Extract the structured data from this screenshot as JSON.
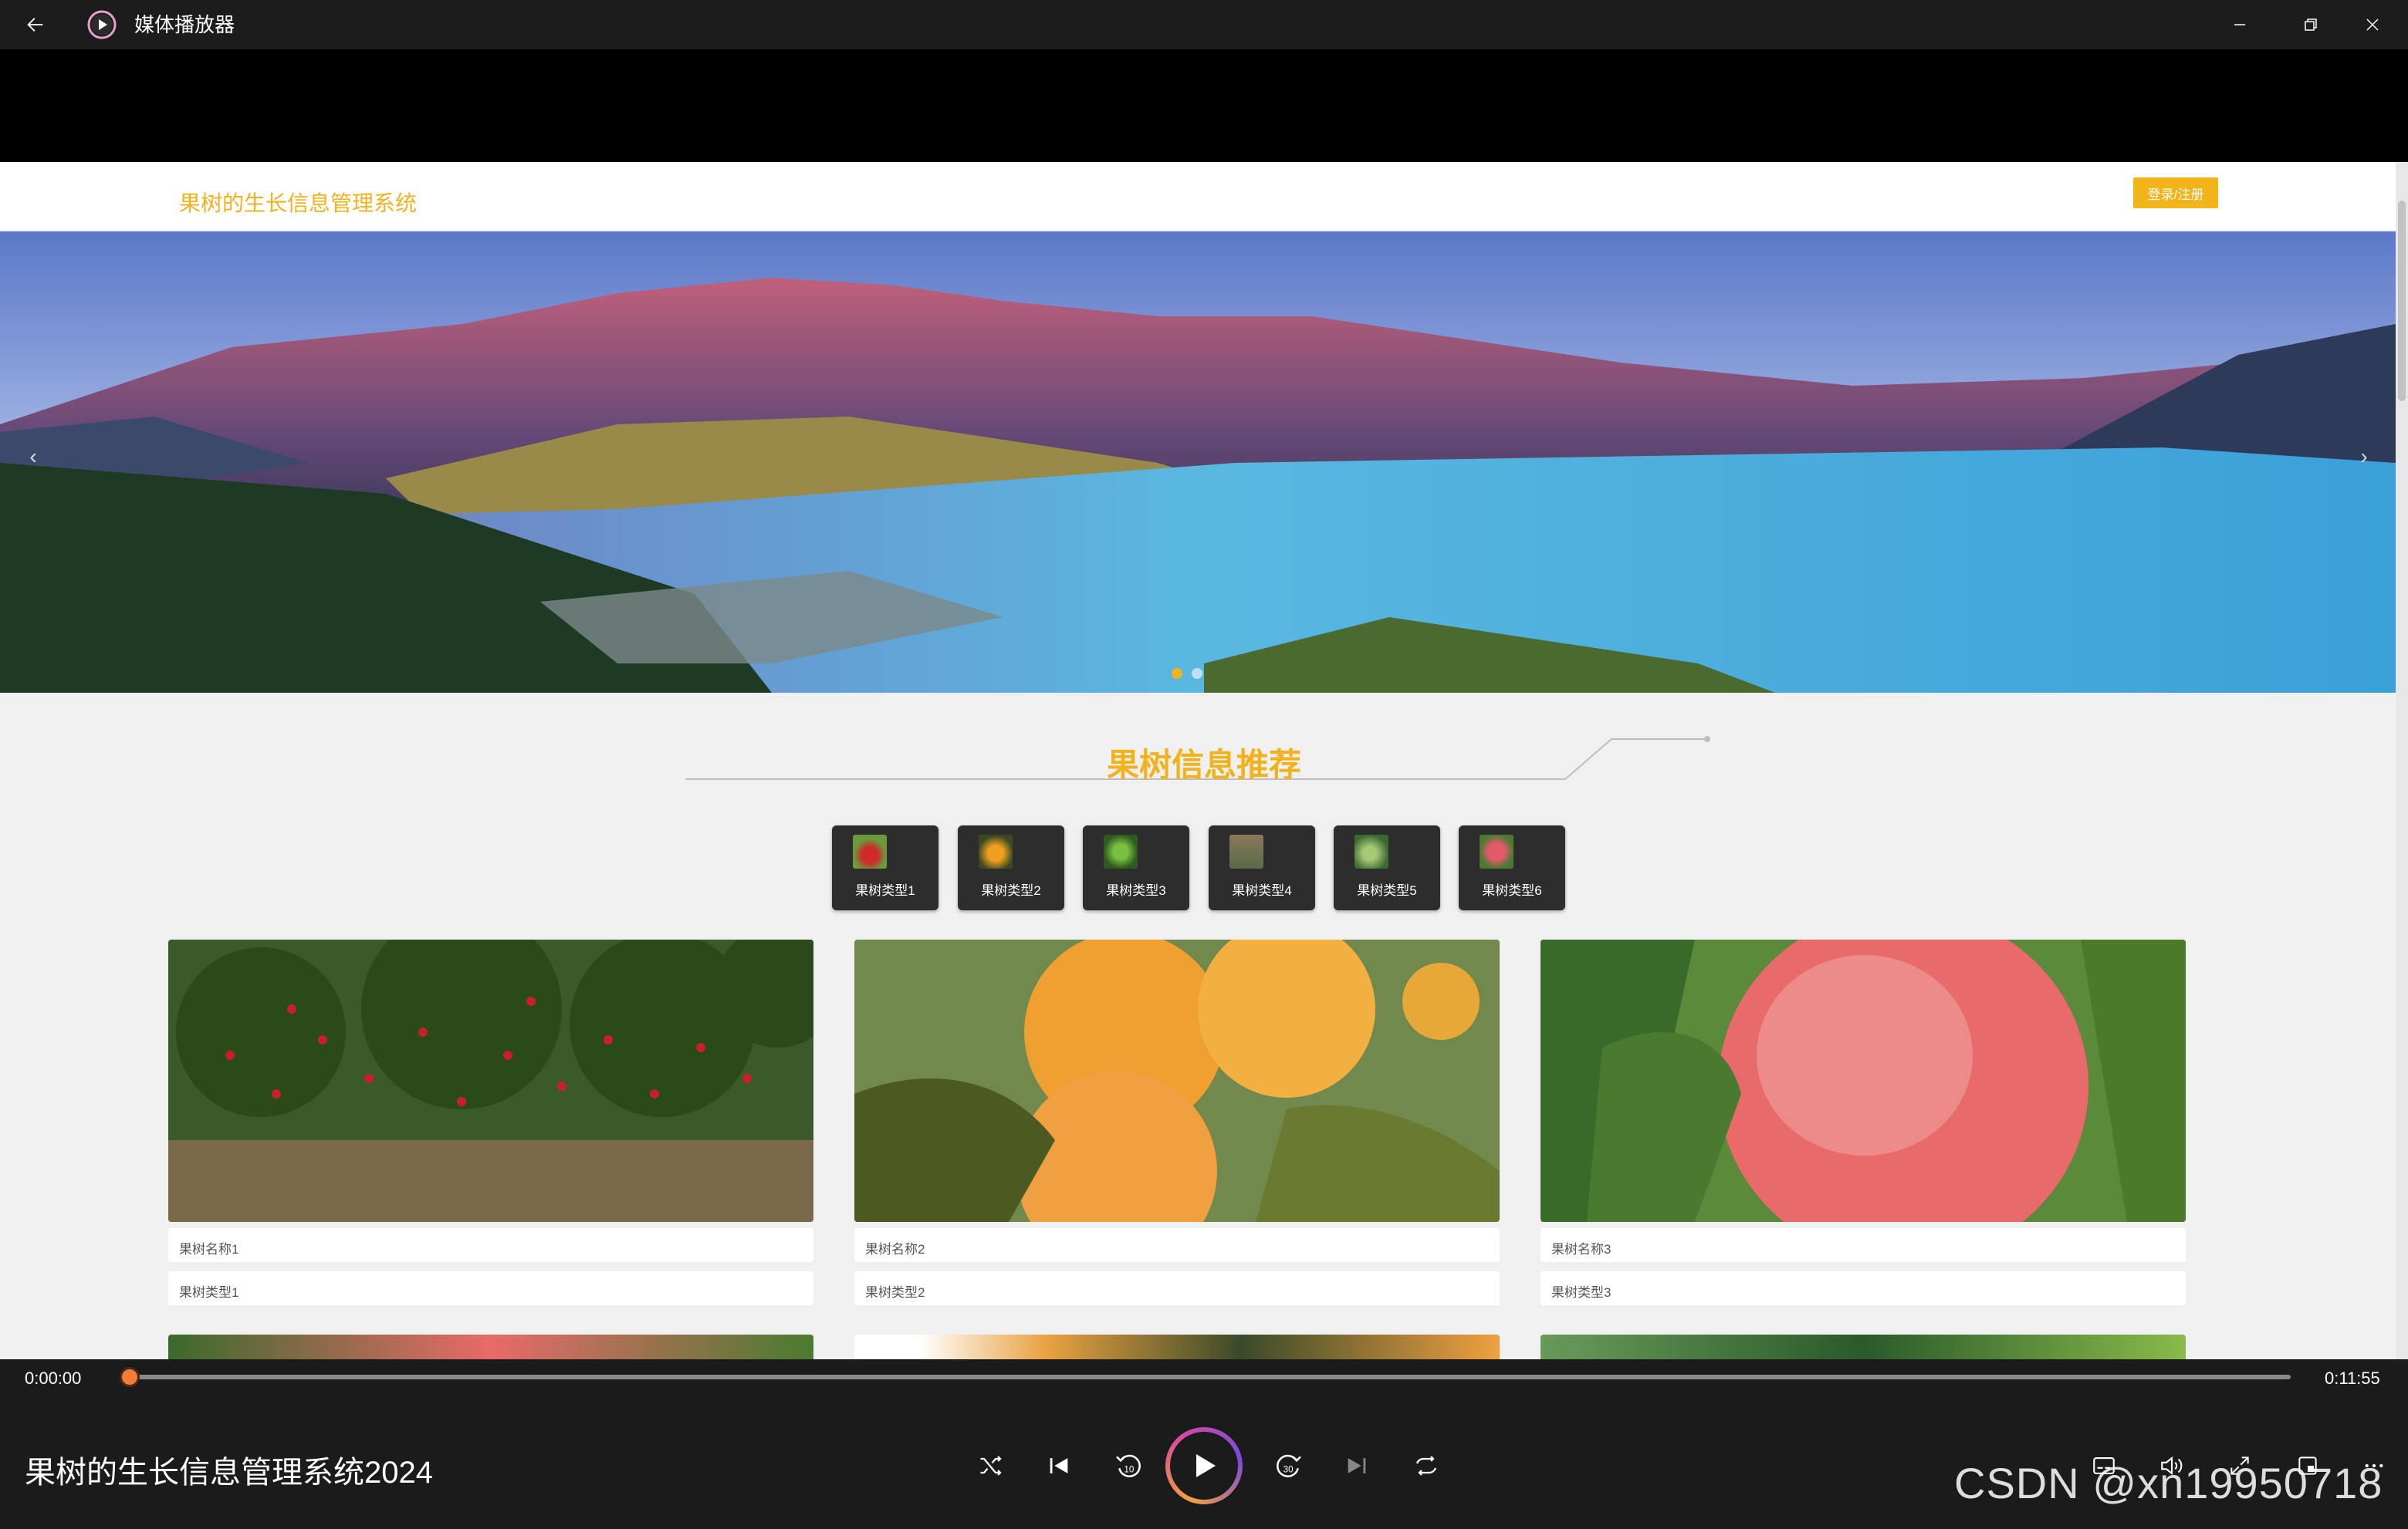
{
  "titlebar": {
    "app_title": "媒体播放器",
    "back_icon": "arrow-left-icon",
    "minimize_icon": "minimize-icon",
    "restore_icon": "restore-icon",
    "close_icon": "close-icon"
  },
  "webpage": {
    "site_title": "果树的生长信息管理系统",
    "login_label": "登录/注册",
    "section_title": "果树信息推荐",
    "types": [
      {
        "label": "果树类型1"
      },
      {
        "label": "果树类型2"
      },
      {
        "label": "果树类型3"
      },
      {
        "label": "果树类型4"
      },
      {
        "label": "果树类型5"
      },
      {
        "label": "果树类型6"
      }
    ],
    "cards": [
      {
        "name": "果树名称1",
        "type": "果树类型1"
      },
      {
        "name": "果树名称2",
        "type": "果树类型2"
      },
      {
        "name": "果树名称3",
        "type": "果树类型3"
      }
    ],
    "accent_color": "#f2b21e"
  },
  "player": {
    "current_time": "0:00:00",
    "total_time": "0:11:55",
    "progress": 0,
    "media_title": "果树的生长信息管理系统2024",
    "controls": [
      "shuffle-icon",
      "previous-icon",
      "rewind-10-icon",
      "play-icon",
      "forward-30-icon",
      "next-icon",
      "repeat-icon",
      "captions-icon",
      "volume-icon",
      "fullscreen-icon",
      "mini-view-icon",
      "more-icon"
    ],
    "skip_back_label": "10",
    "skip_forward_label": "30"
  },
  "watermark": "CSDN @xn19950718"
}
